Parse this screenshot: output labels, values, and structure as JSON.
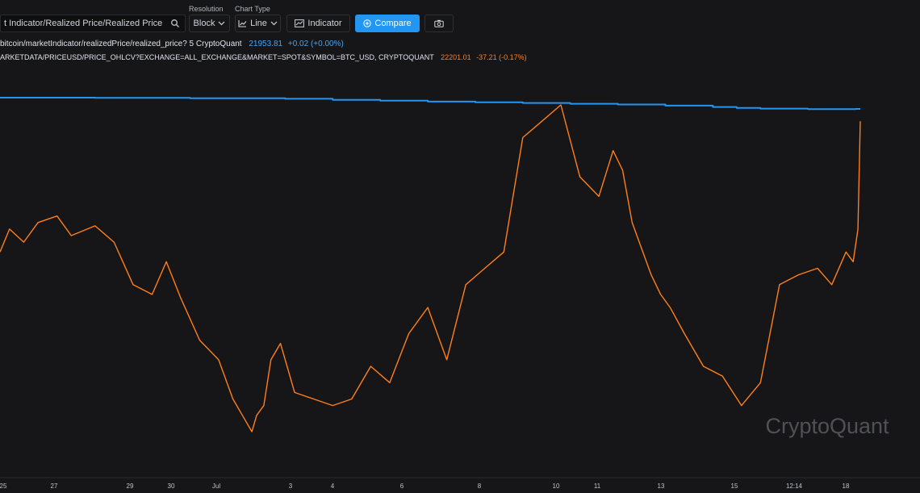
{
  "toolbar": {
    "search_value": "t Indicator/Realized Price/Realized Price",
    "resolution_label": "Resolution",
    "resolution_value": "Block",
    "chart_type_label": "Chart Type",
    "chart_type_value": "Line",
    "indicator_label": "Indicator",
    "compare_label": "Compare"
  },
  "legend": {
    "series1_name": "bitcoin/marketIndicator/realizedPrice/realized_price?  5  CryptoQuant",
    "series1_value": "21953.81",
    "series1_change": "+0.02 (+0.00%)",
    "series2_name": "ARKETDATA/PRICEUSD/PRICE_OHLCV?EXCHANGE=ALL_EXCHANGE&MARKET=SPOT&SYMBOL=BTC_USD, CRYPTOQUANT",
    "series2_value": "22201.01",
    "series2_change": "-37.21 (-0.17%)"
  },
  "colors": {
    "background": "#161618",
    "realized_price": "#2196f3",
    "btc_price": "#ff7f1a",
    "accent": "#2196f3"
  },
  "watermark": "CryptoQuant",
  "chart_data": {
    "type": "line",
    "x_tick_labels": [
      "25",
      "27",
      "29",
      "30",
      "Jul",
      "3",
      "4",
      "6",
      "8",
      "10",
      "11",
      "13",
      "15",
      "12:14",
      "18"
    ],
    "series": [
      {
        "name": "bitcoin/marketIndicator/realizedPrice/realized_price?",
        "color": "#2196f3",
        "x": [
          0,
          2,
          4,
          6,
          7,
          8,
          9,
          10,
          11,
          12,
          13,
          14,
          15,
          15.5,
          16,
          17,
          18,
          18.1
        ],
        "values": [
          1.0,
          0.995,
          0.985,
          0.975,
          0.95,
          0.93,
          0.91,
          0.895,
          0.88,
          0.862,
          0.845,
          0.82,
          0.79,
          0.77,
          0.752,
          0.742,
          0.745,
          0.745
        ]
      },
      {
        "name": "ARKETDATA/PRICEUSD/PRICE_OHLCV?EXCHANGE=ALL_EXCHANGE&MARKET=SPOT&SYMBOL=BTC_USD",
        "color": "#ff7f1a",
        "x": [
          0,
          0.2,
          0.5,
          0.8,
          1.2,
          1.5,
          2,
          2.4,
          2.8,
          3.2,
          3.5,
          3.8,
          4.2,
          4.6,
          4.9,
          5.1,
          5.3,
          5.4,
          5.55,
          5.7,
          5.9,
          6.2,
          6.6,
          7.0,
          7.4,
          7.8,
          8.2,
          8.6,
          9.0,
          9.4,
          9.8,
          10.2,
          10.6,
          11.0,
          11.4,
          11.8,
          12.2,
          12.6,
          12.9,
          13.1,
          13.3,
          13.5,
          13.7,
          13.9,
          14.1,
          14.4,
          14.8,
          15.2,
          15.6,
          16.0,
          16.4,
          16.8,
          17.2,
          17.5,
          17.8,
          17.95,
          18.05,
          18.1
        ],
        "values": [
          0.55,
          0.62,
          0.58,
          0.64,
          0.66,
          0.6,
          0.63,
          0.58,
          0.45,
          0.42,
          0.52,
          0.41,
          0.28,
          0.22,
          0.1,
          0.05,
          0.0,
          0.05,
          0.08,
          0.22,
          0.27,
          0.12,
          0.1,
          0.08,
          0.1,
          0.2,
          0.15,
          0.3,
          0.38,
          0.22,
          0.45,
          0.5,
          0.55,
          0.9,
          0.95,
          1.0,
          0.78,
          0.72,
          0.86,
          0.8,
          0.64,
          0.56,
          0.48,
          0.42,
          0.38,
          0.3,
          0.2,
          0.17,
          0.08,
          0.15,
          0.45,
          0.48,
          0.5,
          0.45,
          0.55,
          0.52,
          0.62,
          0.95
        ]
      }
    ]
  }
}
